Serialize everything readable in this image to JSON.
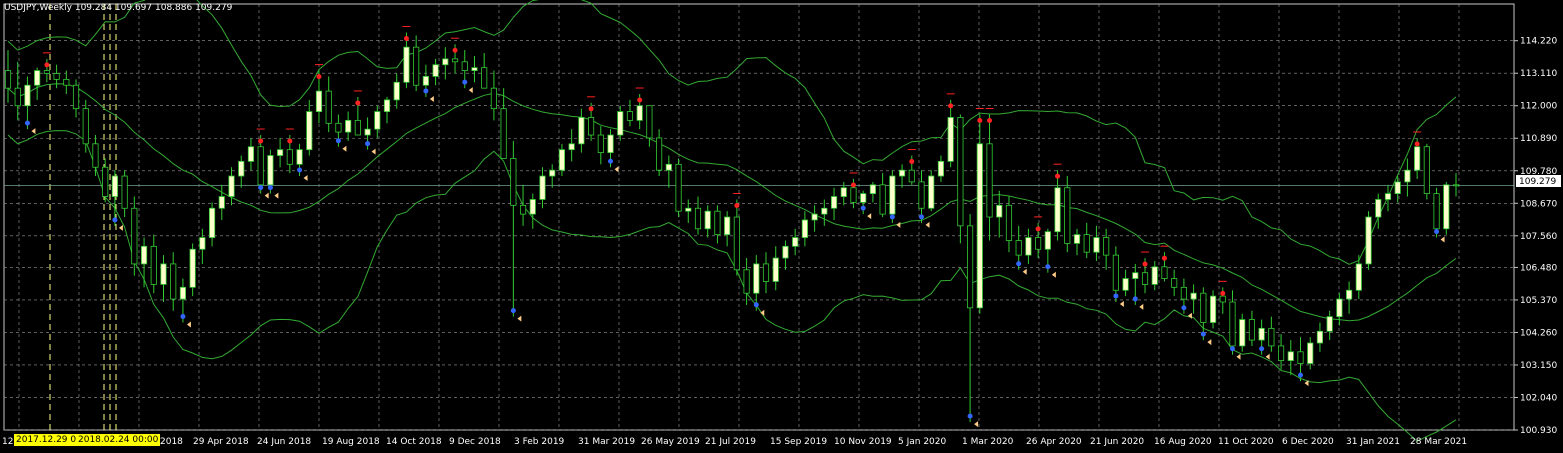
{
  "header": {
    "symbol": "USDJPY,Weekly",
    "ohlc": "109.284 109.697 108.886 109.279"
  },
  "price_badge": "109.279",
  "time_highlights": [
    "2017.12.29 0",
    "2018.02.24 00:00"
  ],
  "x_labels": [
    "12",
    "2018",
    "29 Apr 2018",
    "24 Jun 2018",
    "19 Aug 2018",
    "14 Oct 2018",
    "9 Dec 2018",
    "3 Feb 2019",
    "31 Mar 2019",
    "26 May 2019",
    "21 Jul 2019",
    "15 Sep 2019",
    "10 Nov 2019",
    "5 Jan 2020",
    "1 Mar 2020",
    "26 Apr 2020",
    "21 Jun 2020",
    "16 Aug 2020",
    "11 Oct 2020",
    "6 Dec 2020",
    "31 Jan 2021",
    "28 Mar 2021"
  ],
  "y_labels": [
    "114.220",
    "113.110",
    "112.000",
    "110.890",
    "109.780",
    "108.670",
    "107.560",
    "106.480",
    "105.370",
    "104.260",
    "103.150",
    "102.040",
    "100.930"
  ],
  "colors": {
    "bg": "#000000",
    "grid": "#9a9a9a",
    "bull": "#ffffcc",
    "bear": "#000000",
    "wick": "#33cc33",
    "band": "#33aa33",
    "buy": "#3366ff",
    "sell": "#ff2222",
    "arrow": "#ffcc88",
    "price_line": "#6f9f8f"
  },
  "chart_data": {
    "type": "candlestick",
    "ylim": [
      100.93,
      115.2
    ],
    "series": [
      {
        "name": "USDJPY,Weekly",
        "ohlc": [
          [
            113.2,
            113.9,
            112.1,
            112.6
          ],
          [
            112.6,
            113.5,
            111.5,
            112.0
          ],
          [
            112.0,
            113.0,
            111.2,
            112.7
          ],
          [
            112.7,
            113.3,
            112.2,
            113.2
          ],
          [
            113.2,
            113.6,
            112.8,
            113.1
          ],
          [
            113.1,
            113.4,
            112.6,
            112.9
          ],
          [
            112.9,
            113.2,
            112.4,
            112.7
          ],
          [
            112.7,
            112.9,
            111.6,
            111.9
          ],
          [
            111.9,
            112.2,
            110.4,
            110.7
          ],
          [
            110.7,
            111.0,
            109.6,
            109.9
          ],
          [
            109.9,
            110.2,
            108.7,
            108.9
          ],
          [
            108.9,
            109.8,
            107.9,
            109.6
          ],
          [
            109.6,
            109.8,
            108.2,
            108.5
          ],
          [
            108.5,
            108.9,
            106.2,
            106.6
          ],
          [
            106.6,
            107.5,
            105.8,
            107.2
          ],
          [
            107.2,
            107.6,
            105.6,
            105.9
          ],
          [
            105.9,
            106.9,
            105.3,
            106.6
          ],
          [
            106.6,
            107.0,
            105.0,
            105.4
          ],
          [
            105.4,
            106.1,
            104.6,
            105.8
          ],
          [
            105.8,
            107.3,
            105.5,
            107.1
          ],
          [
            107.1,
            107.8,
            106.6,
            107.5
          ],
          [
            107.5,
            108.7,
            107.2,
            108.5
          ],
          [
            108.5,
            109.3,
            108.1,
            108.9
          ],
          [
            108.9,
            109.9,
            108.6,
            109.6
          ],
          [
            109.6,
            110.3,
            109.2,
            110.1
          ],
          [
            110.1,
            110.9,
            109.8,
            110.6
          ],
          [
            110.6,
            111.0,
            109.0,
            109.3
          ],
          [
            109.3,
            110.5,
            109.0,
            110.3
          ],
          [
            110.3,
            110.9,
            109.9,
            110.5
          ],
          [
            110.5,
            111.0,
            109.7,
            110.0
          ],
          [
            110.0,
            110.7,
            109.6,
            110.5
          ],
          [
            110.5,
            112.2,
            110.3,
            111.8
          ],
          [
            111.8,
            113.2,
            111.4,
            112.5
          ],
          [
            112.5,
            113.0,
            111.1,
            111.4
          ],
          [
            111.4,
            111.7,
            110.6,
            111.1
          ],
          [
            111.1,
            111.8,
            110.8,
            111.5
          ],
          [
            111.5,
            112.3,
            111.2,
            111.0
          ],
          [
            111.0,
            111.6,
            110.5,
            111.2
          ],
          [
            111.2,
            112.0,
            110.9,
            111.8
          ],
          [
            111.8,
            112.3,
            111.4,
            112.2
          ],
          [
            112.2,
            113.1,
            111.9,
            112.8
          ],
          [
            112.8,
            114.5,
            112.6,
            114.0
          ],
          [
            114.0,
            114.4,
            112.5,
            112.7
          ],
          [
            112.7,
            113.4,
            112.3,
            113.0
          ],
          [
            113.0,
            113.6,
            112.7,
            113.4
          ],
          [
            113.4,
            114.0,
            112.9,
            113.6
          ],
          [
            113.6,
            114.1,
            113.1,
            113.5
          ],
          [
            113.5,
            113.9,
            112.6,
            113.2
          ],
          [
            113.2,
            113.7,
            112.8,
            113.3
          ],
          [
            113.3,
            113.8,
            112.7,
            112.6
          ],
          [
            112.6,
            113.2,
            111.5,
            111.9
          ],
          [
            111.9,
            112.6,
            110.9,
            110.2
          ],
          [
            110.2,
            110.8,
            104.8,
            108.6
          ],
          [
            108.6,
            109.3,
            107.9,
            108.3
          ],
          [
            108.3,
            109.0,
            107.8,
            108.8
          ],
          [
            108.8,
            109.9,
            108.5,
            109.6
          ],
          [
            109.6,
            110.0,
            109.2,
            109.8
          ],
          [
            109.8,
            110.7,
            109.6,
            110.5
          ],
          [
            110.5,
            111.2,
            110.1,
            110.7
          ],
          [
            110.7,
            111.9,
            110.4,
            111.6
          ],
          [
            111.6,
            112.1,
            110.8,
            111.0
          ],
          [
            111.0,
            111.3,
            110.0,
            110.4
          ],
          [
            110.4,
            111.2,
            109.9,
            111.0
          ],
          [
            111.0,
            112.0,
            110.8,
            111.8
          ],
          [
            111.8,
            112.2,
            111.3,
            111.5
          ],
          [
            111.5,
            112.4,
            111.2,
            112.0
          ],
          [
            112.0,
            112.0,
            110.6,
            110.9
          ],
          [
            110.9,
            111.2,
            109.6,
            109.8
          ],
          [
            109.8,
            110.3,
            109.2,
            110.0
          ],
          [
            110.0,
            110.2,
            108.2,
            108.4
          ],
          [
            108.4,
            108.8,
            108.0,
            108.5
          ],
          [
            108.5,
            108.9,
            107.6,
            107.8
          ],
          [
            107.8,
            108.6,
            107.5,
            108.4
          ],
          [
            108.4,
            108.6,
            107.3,
            107.6
          ],
          [
            107.6,
            108.4,
            107.2,
            108.2
          ],
          [
            108.2,
            108.8,
            106.2,
            106.4
          ],
          [
            106.4,
            106.8,
            105.2,
            105.6
          ],
          [
            105.6,
            106.9,
            105.0,
            106.6
          ],
          [
            106.6,
            107.0,
            105.6,
            106.0
          ],
          [
            106.0,
            107.2,
            105.7,
            106.8
          ],
          [
            106.8,
            107.4,
            106.4,
            107.2
          ],
          [
            107.2,
            107.8,
            106.9,
            107.5
          ],
          [
            107.5,
            108.4,
            107.2,
            108.1
          ],
          [
            108.1,
            108.6,
            107.7,
            108.3
          ],
          [
            108.3,
            108.8,
            107.9,
            108.5
          ],
          [
            108.5,
            109.2,
            108.1,
            108.9
          ],
          [
            108.9,
            109.4,
            108.6,
            109.2
          ],
          [
            109.2,
            109.5,
            108.5,
            108.7
          ],
          [
            108.7,
            109.1,
            108.3,
            109.0
          ],
          [
            109.0,
            109.4,
            108.7,
            109.3
          ],
          [
            109.3,
            109.7,
            108.2,
            108.3
          ],
          [
            108.3,
            109.8,
            108.0,
            109.6
          ],
          [
            109.6,
            110.0,
            109.2,
            109.8
          ],
          [
            109.8,
            110.3,
            109.3,
            109.4
          ],
          [
            109.4,
            109.8,
            108.0,
            108.5
          ],
          [
            108.5,
            109.8,
            108.4,
            109.6
          ],
          [
            109.6,
            110.3,
            109.4,
            110.1
          ],
          [
            110.1,
            112.2,
            109.9,
            111.6
          ],
          [
            111.6,
            111.7,
            107.3,
            107.9
          ],
          [
            107.9,
            108.3,
            101.2,
            105.1
          ],
          [
            105.1,
            111.7,
            104.9,
            110.7
          ],
          [
            110.7,
            111.7,
            107.4,
            108.2
          ],
          [
            108.2,
            109.1,
            107.5,
            108.6
          ],
          [
            108.6,
            108.9,
            107.0,
            107.4
          ],
          [
            107.4,
            107.9,
            106.4,
            106.9
          ],
          [
            106.9,
            107.8,
            106.6,
            107.5
          ],
          [
            107.5,
            108.0,
            106.8,
            107.1
          ],
          [
            107.1,
            107.8,
            106.3,
            107.7
          ],
          [
            107.7,
            109.8,
            107.4,
            109.2
          ],
          [
            109.2,
            109.6,
            107.0,
            107.3
          ],
          [
            107.3,
            107.8,
            106.9,
            107.6
          ],
          [
            107.6,
            108.0,
            106.8,
            107.0
          ],
          [
            107.0,
            107.9,
            106.7,
            107.5
          ],
          [
            107.5,
            107.8,
            106.4,
            106.9
          ],
          [
            106.9,
            107.2,
            105.3,
            105.7
          ],
          [
            105.7,
            106.4,
            105.5,
            106.1
          ],
          [
            106.1,
            106.6,
            105.2,
            106.3
          ],
          [
            106.3,
            106.8,
            105.6,
            105.9
          ],
          [
            105.9,
            106.7,
            105.7,
            106.5
          ],
          [
            106.5,
            107.0,
            106.0,
            106.1
          ],
          [
            106.1,
            106.4,
            105.5,
            105.8
          ],
          [
            105.8,
            106.1,
            104.9,
            105.4
          ],
          [
            105.4,
            105.9,
            104.9,
            105.6
          ],
          [
            105.6,
            105.8,
            104.0,
            104.6
          ],
          [
            104.6,
            105.7,
            104.4,
            105.5
          ],
          [
            105.5,
            105.8,
            104.9,
            105.3
          ],
          [
            105.3,
            105.7,
            103.5,
            103.8
          ],
          [
            103.8,
            104.9,
            103.6,
            104.7
          ],
          [
            104.7,
            105.0,
            103.8,
            104.0
          ],
          [
            104.0,
            104.7,
            103.5,
            104.4
          ],
          [
            104.4,
            104.8,
            103.6,
            103.8
          ],
          [
            103.8,
            104.2,
            103.0,
            103.3
          ],
          [
            103.3,
            104.0,
            102.8,
            103.6
          ],
          [
            103.6,
            104.1,
            102.6,
            103.2
          ],
          [
            103.2,
            104.1,
            103.0,
            103.9
          ],
          [
            103.9,
            104.6,
            103.6,
            104.3
          ],
          [
            104.3,
            105.0,
            104.0,
            104.8
          ],
          [
            104.8,
            105.6,
            104.5,
            105.4
          ],
          [
            105.4,
            106.0,
            104.9,
            105.7
          ],
          [
            105.7,
            106.9,
            105.4,
            106.6
          ],
          [
            106.6,
            108.4,
            106.4,
            108.2
          ],
          [
            108.2,
            109.0,
            107.8,
            108.8
          ],
          [
            108.8,
            109.3,
            108.4,
            109.0
          ],
          [
            109.0,
            109.6,
            108.7,
            109.4
          ],
          [
            109.4,
            110.2,
            108.9,
            109.8
          ],
          [
            109.8,
            110.9,
            109.5,
            110.6
          ],
          [
            110.6,
            110.7,
            108.8,
            109.0
          ],
          [
            109.0,
            109.2,
            107.5,
            107.8
          ],
          [
            107.8,
            109.4,
            107.6,
            109.3
          ],
          [
            109.3,
            109.7,
            108.9,
            109.28
          ]
        ]
      }
    ]
  }
}
